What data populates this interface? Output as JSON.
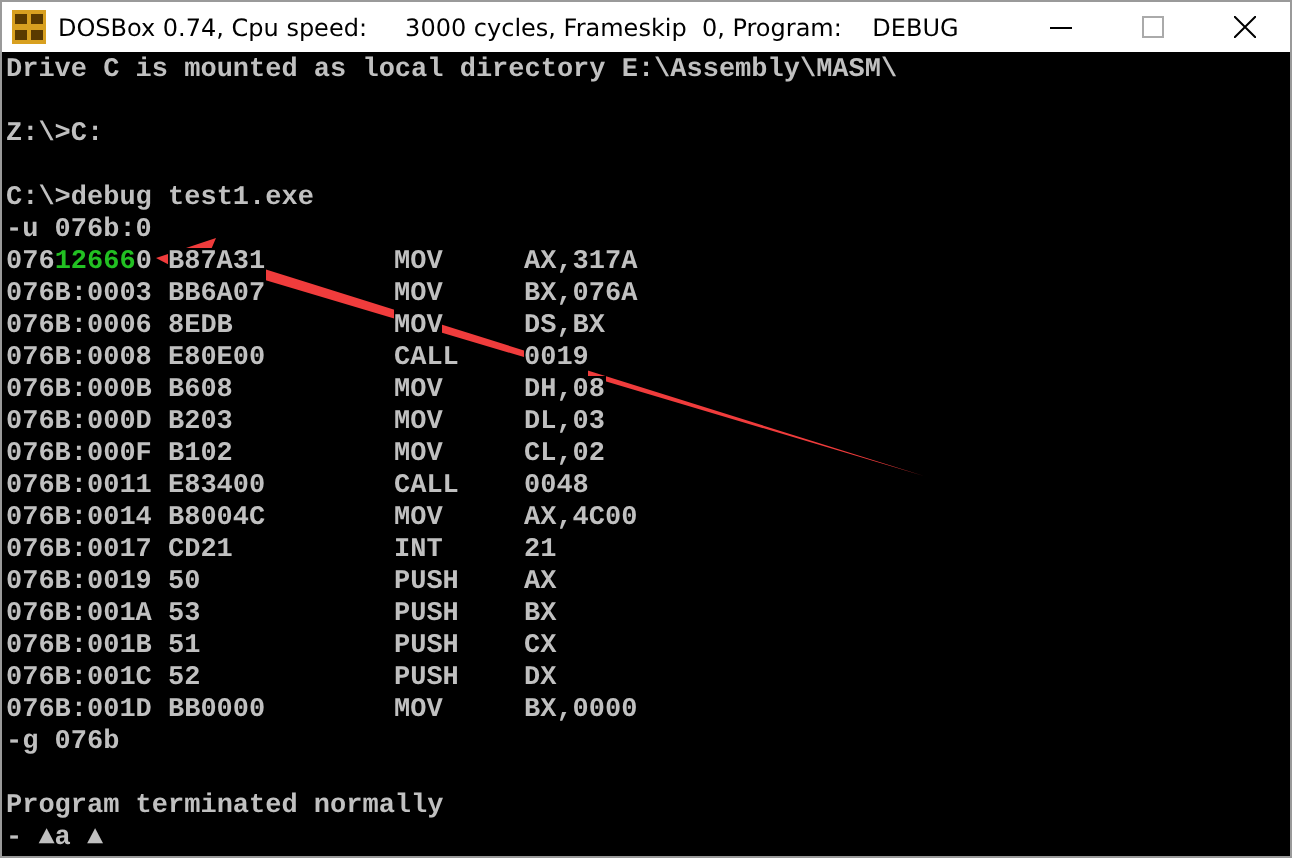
{
  "window": {
    "title": "DOSBox 0.74, Cpu speed:     3000 cycles, Frameskip  0, Program:    DEBUG"
  },
  "console": {
    "lines_before": [
      {
        "kind": "text",
        "text": "Drive C is mounted as local directory E:\\Assembly\\MASM\\"
      },
      {
        "kind": "blank"
      },
      {
        "kind": "text",
        "text": "Z:\\>C:"
      },
      {
        "kind": "blank"
      },
      {
        "kind": "text",
        "text": "C:\\>debug test1.exe"
      },
      {
        "kind": "text",
        "text": "-u 076b:0"
      }
    ],
    "rows": [
      {
        "address": "076",
        "address_highlight": "12666",
        "address_suffix": "0",
        "bytes": "B87A31",
        "mnemonic": "MOV",
        "operands": "AX,317A"
      },
      {
        "address": "076B:0003",
        "bytes": "BB6A07",
        "mnemonic": "MOV",
        "operands": "BX,076A"
      },
      {
        "address": "076B:0006",
        "bytes": "8EDB",
        "mnemonic": "MOV",
        "operands": "DS,BX"
      },
      {
        "address": "076B:0008",
        "bytes": "E80E00",
        "mnemonic": "CALL",
        "operands": "0019"
      },
      {
        "address": "076B:000B",
        "bytes": "B608",
        "mnemonic": "MOV",
        "operands": "DH,08"
      },
      {
        "address": "076B:000D",
        "bytes": "B203",
        "mnemonic": "MOV",
        "operands": "DL,03"
      },
      {
        "address": "076B:000F",
        "bytes": "B102",
        "mnemonic": "MOV",
        "operands": "CL,02"
      },
      {
        "address": "076B:0011",
        "bytes": "E83400",
        "mnemonic": "CALL",
        "operands": "0048"
      },
      {
        "address": "076B:0014",
        "bytes": "B8004C",
        "mnemonic": "MOV",
        "operands": "AX,4C00"
      },
      {
        "address": "076B:0017",
        "bytes": "CD21",
        "mnemonic": "INT",
        "operands": "21"
      },
      {
        "address": "076B:0019",
        "bytes": "50",
        "mnemonic": "PUSH",
        "operands": "AX"
      },
      {
        "address": "076B:001A",
        "bytes": "53",
        "mnemonic": "PUSH",
        "operands": "BX"
      },
      {
        "address": "076B:001B",
        "bytes": "51",
        "mnemonic": "PUSH",
        "operands": "CX"
      },
      {
        "address": "076B:001C",
        "bytes": "52",
        "mnemonic": "PUSH",
        "operands": "DX"
      },
      {
        "address": "076B:001D",
        "bytes": "BB0000",
        "mnemonic": "MOV",
        "operands": "BX,0000"
      }
    ],
    "lines_after": [
      {
        "kind": "text",
        "text": "-g 076b"
      },
      {
        "kind": "blank"
      },
      {
        "kind": "text",
        "text": "Program terminated normally"
      },
      {
        "kind": "text",
        "text": "- ▲a ▲"
      }
    ]
  }
}
